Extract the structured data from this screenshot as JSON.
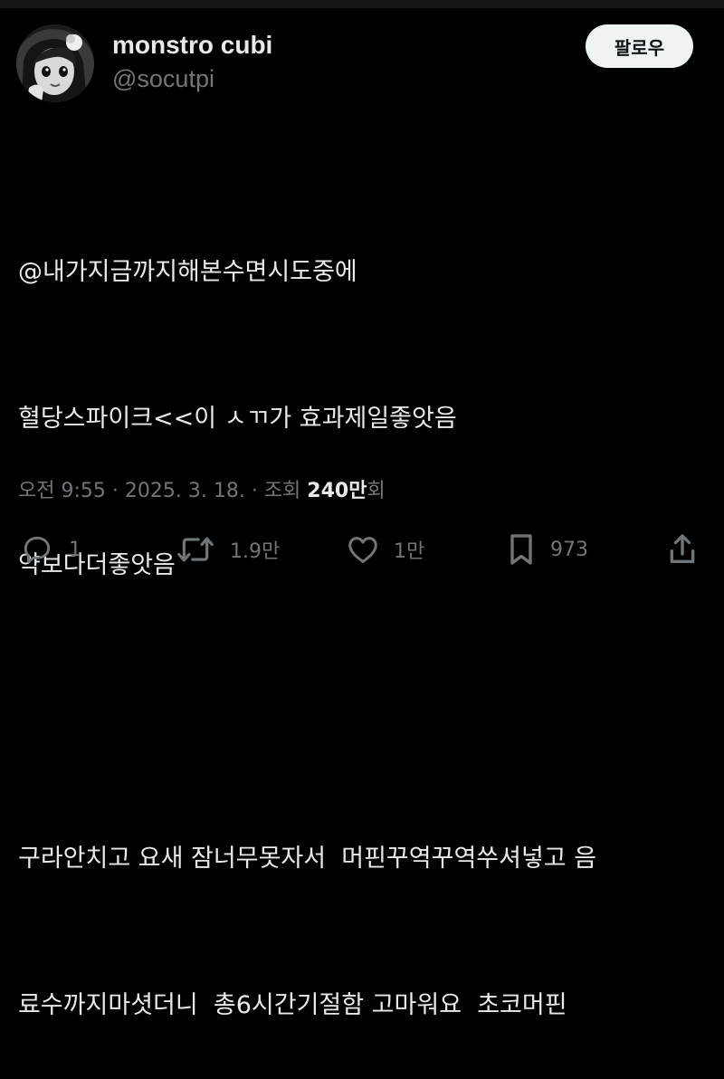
{
  "author": {
    "display_name": "monstro cubi",
    "handle": "@socutpi",
    "avatar_icon": "anime-avatar"
  },
  "follow_button": {
    "label": "팔로우"
  },
  "tweet": {
    "lines": [
      "@내가지금까지해본수면시도중에",
      "혈당스파이크<<이 ㅅㄲ가 효과제일좋앗음",
      "약보다더좋앗음",
      "",
      "구라안치고 요새 잠너무못자서  머핀꾸역꾸역쑤셔넣고 음",
      "료수까지마셧더니  총6시간기절함 고마워요  초코머핀"
    ]
  },
  "meta": {
    "time": "오전 9:55",
    "separator1": " · ",
    "date": "2025. 3. 18.",
    "separator2": " · ",
    "views_label": "조회 ",
    "views_count": "240만",
    "views_suffix": "회"
  },
  "actions": {
    "reply": {
      "icon": "reply-icon",
      "count": "1"
    },
    "retweet": {
      "icon": "retweet-icon",
      "count": "1.9만"
    },
    "like": {
      "icon": "heart-icon",
      "count": "1만"
    },
    "bookmark": {
      "icon": "bookmark-icon",
      "count": "973"
    },
    "share": {
      "icon": "share-icon"
    }
  },
  "colors": {
    "background": "#000000",
    "text_primary": "#e7e9ea",
    "text_secondary": "#71767b",
    "button_bg": "#eff3f4"
  }
}
